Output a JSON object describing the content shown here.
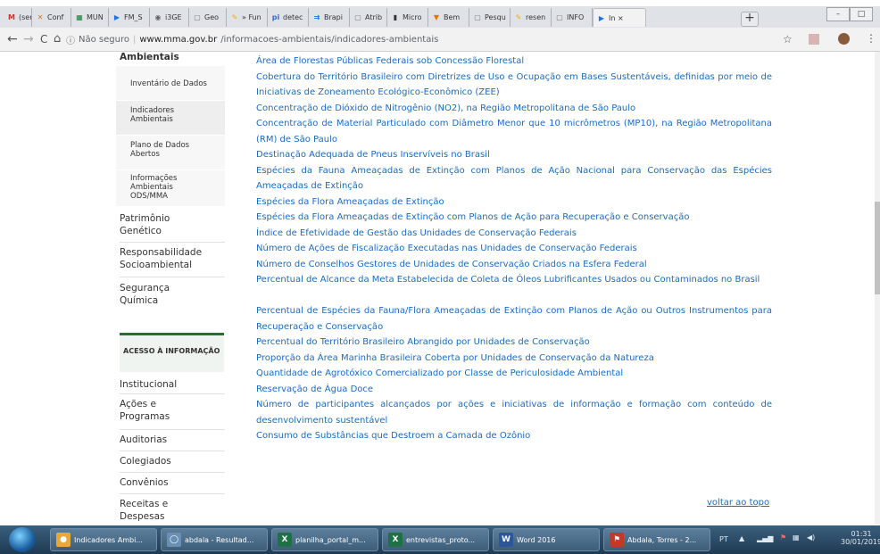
{
  "browser": {
    "tabs": [
      {
        "label": "(sem",
        "icon": "gmail-icon"
      },
      {
        "label": "Conf",
        "icon": "x-icon"
      },
      {
        "label": "MUN",
        "icon": "sheet-icon"
      },
      {
        "label": "FM_S",
        "icon": "flag-icon"
      },
      {
        "label": "i3GE",
        "icon": "eye-icon"
      },
      {
        "label": "Geo",
        "icon": "page-icon"
      },
      {
        "label": "» Fun",
        "icon": "pencil-icon"
      },
      {
        "label": "detec",
        "icon": "pi-icon"
      },
      {
        "label": "Brapi",
        "icon": "brapi-icon"
      },
      {
        "label": "Atrib",
        "icon": "page-icon"
      },
      {
        "label": "Micro",
        "icon": "bars-icon"
      },
      {
        "label": "Bem",
        "icon": "news-icon"
      },
      {
        "label": "Pesqu",
        "icon": "page-icon"
      },
      {
        "label": "resen",
        "icon": "pencil-icon"
      },
      {
        "label": "INFO",
        "icon": "page-icon"
      },
      {
        "label": "In ×",
        "icon": "flag-icon"
      }
    ],
    "address": {
      "security": "Não seguro",
      "host": "www.mma.gov.br",
      "path": "/informacoes-ambientais/indicadores-ambientais"
    }
  },
  "sidebar": {
    "heading": "Ambientais",
    "subitems": [
      "Inventário de Dados",
      "Indicadores Ambientais",
      "Plano de Dados Abertos",
      "Informações Ambientais ODS/MMA"
    ],
    "items": [
      "Patrimônio Genético",
      "Responsabilidade Socioambiental",
      "Segurança Química"
    ],
    "acesso_title": "ACESSO À INFORMAÇÃO",
    "acesso_items": [
      "Institucional",
      "Ações e Programas",
      "Auditorias",
      "Colegiados",
      "Convênios",
      "Receitas e Despesas"
    ]
  },
  "indicators": [
    "Área de Florestas Públicas Federais sob Concessão Florestal",
    "Cobertura do Território Brasileiro com Diretrizes de Uso e Ocupação em Bases Sustentáveis, definidas por meio de Iniciativas de Zoneamento Ecológico-Econômico (ZEE)",
    "Concentração de Dióxido de Nitrogênio (NO2), na Região Metropolitana de São Paulo",
    "Concentração de Material Particulado com Diâmetro Menor que 10 micrômetros (MP10), na Região Metropolitana (RM) de São Paulo",
    "Destinação Adequada de Pneus Inservíveis no Brasil",
    "Espécies da Fauna Ameaçadas de Extinção com Planos de Ação Nacional para Conservação das Espécies Ameaçadas de Extinção",
    "Espécies da Flora Ameaçadas de Extinção",
    "Espécies da Flora Ameaçadas de Extinção com Planos de Ação para Recuperação e Conservação",
    "Índice de Efetividade de Gestão das Unidades de Conservação Federais",
    "Número de Ações de Fiscalização Executadas nas Unidades de Conservação Federais",
    "Número de Conselhos Gestores de Unidades de Conservação Criados na Esfera Federal",
    "Percentual de Alcance da Meta Estabelecida de Coleta de Óleos Lubrificantes Usados ou Contaminados no Brasil",
    "Percentual de Espécies da Fauna/Flora Ameaçadas de Extinção com Planos de Ação ou Outros Instrumentos para Recuperação e Conservação",
    "Percentual do Território Brasileiro Abrangido por Unidades de Conservação",
    "Proporção da Área Marinha Brasileira Coberta por Unidades de Conservação da Natureza",
    "Quantidade de Agrotóxico Comercializado por Classe de Periculosidade Ambiental",
    "Reservação de Água Doce",
    "Número de participantes alcançados por ações e iniciativas de informação e formação com conteúdo de desenvolvimento sustentável",
    "Consumo de Substâncias que Destroem a Camada de Ozônio"
  ],
  "back_to_top": "voltar ao topo",
  "taskbar": {
    "buttons": [
      {
        "label": "Indicadores Ambi...",
        "icon": "chrome-icon"
      },
      {
        "label": "abdala - Resultad...",
        "icon": "search-icon"
      },
      {
        "label": "planilha_portal_m...",
        "icon": "excel-icon"
      },
      {
        "label": "entrevistas_proto...",
        "icon": "excel-icon"
      },
      {
        "label": "Word 2016",
        "icon": "word-icon"
      },
      {
        "label": "Abdala, Torres - 2...",
        "icon": "pdf-icon"
      }
    ],
    "lang": "PT",
    "time": "01:31",
    "date": "30/01/2019"
  }
}
